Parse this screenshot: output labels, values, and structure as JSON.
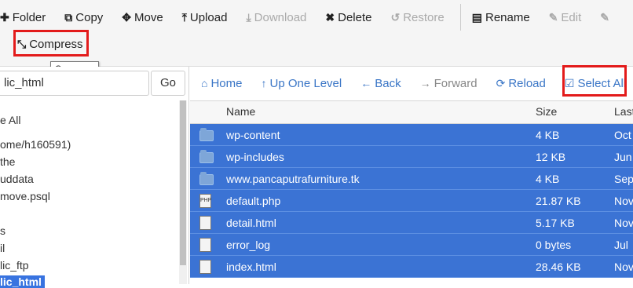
{
  "toolbar": {
    "folder": "Folder",
    "copy": "Copy",
    "move": "Move",
    "upload": "Upload",
    "download": "Download",
    "delete": "Delete",
    "restore": "Restore",
    "rename": "Rename",
    "edit": "Edit",
    "compress": "Compress",
    "tooltip": "Compress"
  },
  "left": {
    "path_value": "lic_html",
    "go": "Go",
    "tree": [
      {
        "label": "e All",
        "active": false
      },
      {
        "label": "ome/h160591)",
        "active": false
      },
      {
        "label": "the",
        "active": false
      },
      {
        "label": "uddata",
        "active": false
      },
      {
        "label": "move.psql",
        "active": false
      },
      {
        "label": "s",
        "active": false
      },
      {
        "label": "il",
        "active": false
      },
      {
        "label": "lic_ftp",
        "active": false
      },
      {
        "label": "lic_html",
        "active": true
      }
    ]
  },
  "nav": {
    "home": "Home",
    "up": "Up One Level",
    "back": "Back",
    "forward": "Forward",
    "reload": "Reload",
    "select_all": "Select All"
  },
  "table": {
    "headers": {
      "name": "Name",
      "size": "Size",
      "last": "Last"
    },
    "rows": [
      {
        "icon": "folder-icon",
        "name": "wp-content",
        "size": "4 KB",
        "last": "Oct"
      },
      {
        "icon": "folder-icon",
        "name": "wp-includes",
        "size": "12 KB",
        "last": "Jun"
      },
      {
        "icon": "folder-icon",
        "name": "www.pancaputrafurniture.tk",
        "size": "4 KB",
        "last": "Sep"
      },
      {
        "icon": "php-file-icon",
        "name": "default.php",
        "size": "21.87 KB",
        "last": "Nov"
      },
      {
        "icon": "html-file-icon",
        "name": "detail.html",
        "size": "5.17 KB",
        "last": "Nov"
      },
      {
        "icon": "text-file-icon",
        "name": "error_log",
        "size": "0 bytes",
        "last": "Jul"
      },
      {
        "icon": "html-file-icon",
        "name": "index.html",
        "size": "28.46 KB",
        "last": "Nov"
      }
    ]
  },
  "colors": {
    "accent": "#3975c6",
    "selected_row": "#3b73d4",
    "highlight": "#e31b1b"
  }
}
